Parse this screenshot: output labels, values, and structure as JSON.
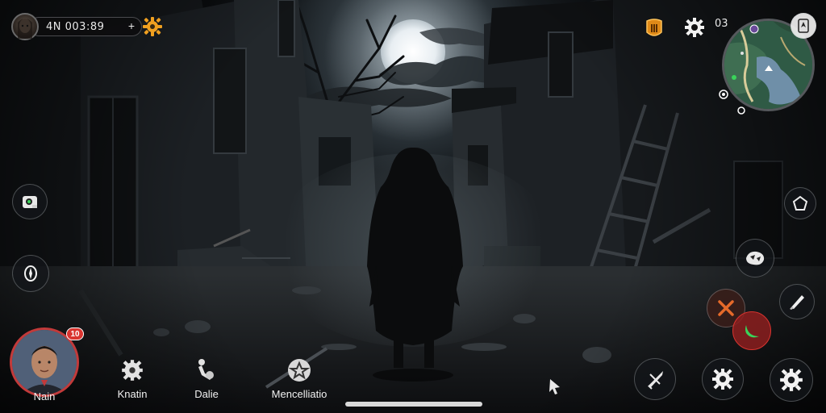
{
  "player": {
    "id_text": "4N 003:89",
    "plus": "+"
  },
  "top_right": {
    "counter": "03"
  },
  "profile": {
    "name": "Nain",
    "badge": "10"
  },
  "bottom_nav": [
    {
      "label": "Knatin",
      "icon": "gear-icon"
    },
    {
      "label": "Dalie",
      "icon": "pin-icon"
    },
    {
      "label": "Mencelliatio",
      "icon": "star-badge-icon"
    }
  ],
  "left_buttons": [
    {
      "icon": "camera-icon"
    },
    {
      "icon": "compass-icon"
    }
  ],
  "right_buttons": [
    {
      "icon": "pentagon-icon"
    },
    {
      "icon": "grenade-icon"
    },
    {
      "icon": "knife-icon"
    },
    {
      "icon": "cross-swords-icon"
    },
    {
      "icon": "crescent-icon"
    },
    {
      "icon": "bullet-icon"
    },
    {
      "icon": "gear-icon"
    },
    {
      "icon": "settings-icon"
    }
  ],
  "colors": {
    "accent_red": "#d9342f",
    "moon": "#e8eef2",
    "badge_gold": "#f0a020"
  }
}
